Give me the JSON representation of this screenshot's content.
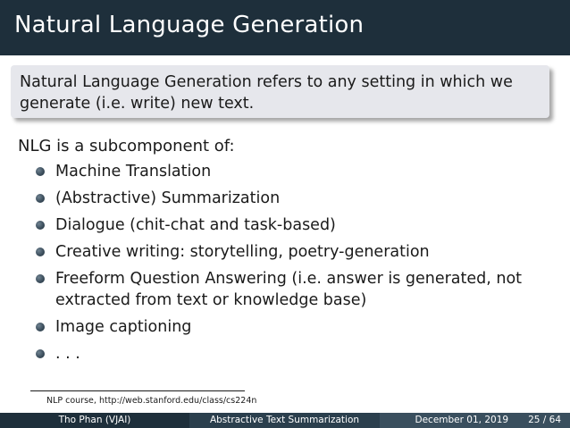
{
  "slide": {
    "title": "Natural Language Generation",
    "definition": "Natural Language Generation refers to any setting in which we generate (i.e. write) new text.",
    "intro": "NLG is a subcomponent of:",
    "items": [
      "Machine Translation",
      "(Abstractive) Summarization",
      "Dialogue (chit-chat and task-based)",
      "Creative writing: storytelling, poetry-generation",
      "Freeform Question Answering (i.e. answer is generated, not extracted from text or knowledge base)",
      "Image captioning",
      ". . ."
    ],
    "footnote": "NLP course, http://web.stanford.edu/class/cs224n"
  },
  "footer": {
    "author": "Tho Phan  (VJAI)",
    "talk_title": "Abstractive Text Summarization",
    "date": "December 01, 2019",
    "page": "25 / 64"
  },
  "colors": {
    "title_bar": "#1e2f3b",
    "definition_box": "#e6e7ec",
    "bullet": "#3d4f5d"
  }
}
